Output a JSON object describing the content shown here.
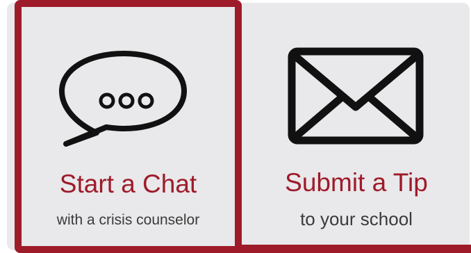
{
  "options": [
    {
      "title": "Start a Chat",
      "subtitle": "with a crisis counselor",
      "icon": "chat-bubble-icon",
      "selected": true
    },
    {
      "title": "Submit a Tip",
      "subtitle": "to your school",
      "icon": "envelope-icon",
      "selected": false
    }
  ],
  "colors": {
    "accent": "#9e1b2a",
    "panel_bg": "#e9e8ea",
    "icon": "#111111",
    "subtitle_text": "#3a3a3a"
  }
}
